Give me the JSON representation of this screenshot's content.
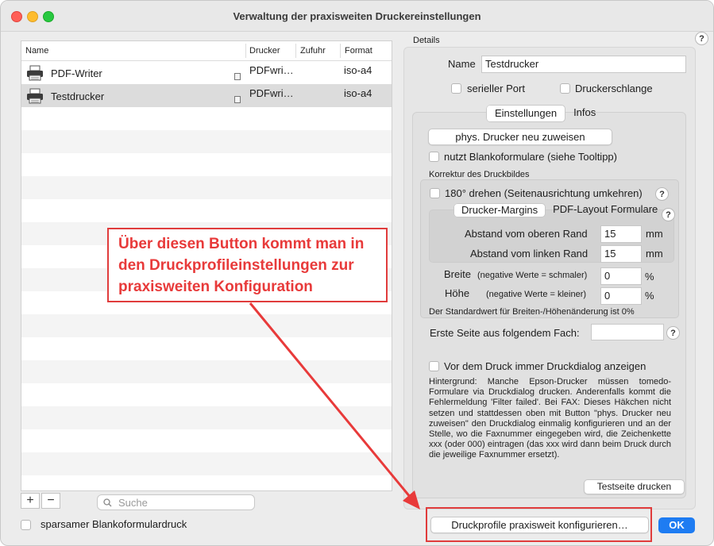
{
  "window": {
    "title": "Verwaltung der praxisweiten Druckereinstellungen"
  },
  "table": {
    "columns": [
      "Name",
      "Drucker",
      "Zufuhr",
      "Format"
    ],
    "rows": [
      {
        "name": "PDF-Writer",
        "drucker": "PDFwri…",
        "zufuhr": "",
        "format": "iso-a4"
      },
      {
        "name": "Testdrucker",
        "drucker": "PDFwri…",
        "zufuhr": "",
        "format": "iso-a4"
      }
    ]
  },
  "left_bottom": {
    "add_label": "+",
    "remove_label": "−",
    "search_placeholder": "Suche",
    "sparsam_label": "sparsamer Blankoformulardruck"
  },
  "details": {
    "group_label": "Details",
    "name_label": "Name",
    "name_value": "Testdrucker",
    "serial_label": "serieller Port",
    "queue_label": "Druckerschlange",
    "tabs": [
      "Einstellungen",
      "Infos"
    ],
    "assign_button": "phys. Drucker neu zuweisen",
    "blanko_label": "nutzt Blankoformulare (siehe Tooltipp)",
    "korrektur_label": "Korrektur des Druckbildes",
    "rotate_label": "180° drehen (Seitenausrichtung umkehren)",
    "margin_tabs": [
      "Drucker-Margins",
      "PDF-Layout Formulare"
    ],
    "top_margin_label": "Abstand vom oberen Rand",
    "top_margin_value": "15",
    "left_margin_label": "Abstand vom linken Rand",
    "left_margin_value": "15",
    "unit_mm": "mm",
    "width_label": "Breite",
    "width_hint": "(negative Werte = schmaler)",
    "width_value": "0",
    "height_label": "Höhe",
    "height_hint": "(negative Werte = kleiner)",
    "height_value": "0",
    "unit_pct": "%",
    "default_note": "Der Standardwert für Breiten-/Höhenänderung ist 0%",
    "first_page_label": "Erste Seite aus folgendem Fach:",
    "first_page_value": "",
    "dialog_label": "Vor dem Druck immer Druckdialog anzeigen",
    "background_text": "Hintergrund: Manche Epson-Drucker müssen tomedo-Formulare via Druckdialog drucken. Anderenfalls kommt die Fehlermeldung 'Filter failed'. Bei FAX: Dieses Häkchen nicht setzen und stattdessen oben mit Button \"phys. Drucker neu zuweisen\" den Druckdialog einmalig konfigurieren und an der Stelle, wo die Faxnummer eingegeben wird, die Zeichenkette xxx (oder 000) eintragen (das xxx wird dann beim Druck durch die jeweilige Faxnummer ersetzt).",
    "test_button": "Testseite drucken"
  },
  "footer": {
    "configure_button": "Druckprofile praxisweit konfigurieren…",
    "ok_button": "OK"
  },
  "annotation": {
    "text": "Über diesen Button kommt man in den Druckprofileinstellungen zur praxisweiten Konfiguration",
    "color": "#e83a3a"
  },
  "help_label": "?"
}
